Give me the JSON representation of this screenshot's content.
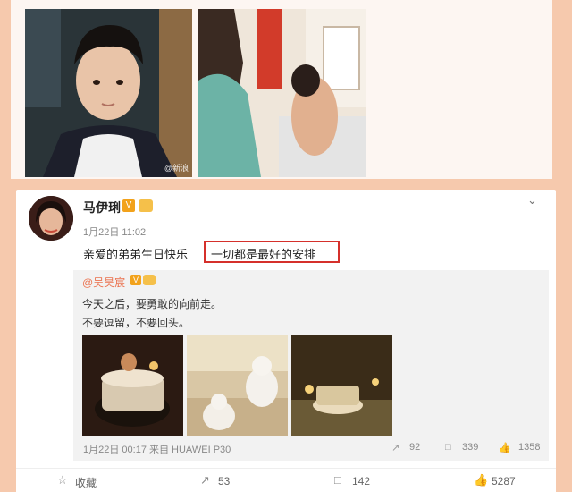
{
  "top_photos": {
    "watermark": "@新浪"
  },
  "post": {
    "username": "马伊琍",
    "v_badge": "V",
    "time": "1月22日 11:02",
    "text": "亲爱的弟弟生日快乐",
    "highlight_text": "一切都是最好的安排",
    "more_icon": "chevron-down-icon"
  },
  "repost": {
    "username": "@吴昊宸",
    "v_badge": "V",
    "line1": "今天之后，要勇敢的向前走。",
    "line2": "不要逗留，不要回头。",
    "meta_time": "1月22日 00:17 来自 HUAWEI P30",
    "stats": {
      "forward": "92",
      "comment": "339",
      "like": "1358"
    }
  },
  "actions": {
    "favorite": "收藏",
    "forward": "53",
    "comment": "142",
    "like": "5287"
  },
  "colors": {
    "page_bg": "#f6c9ad",
    "highlight_border": "#d5302b",
    "mention": "#eb7350"
  }
}
